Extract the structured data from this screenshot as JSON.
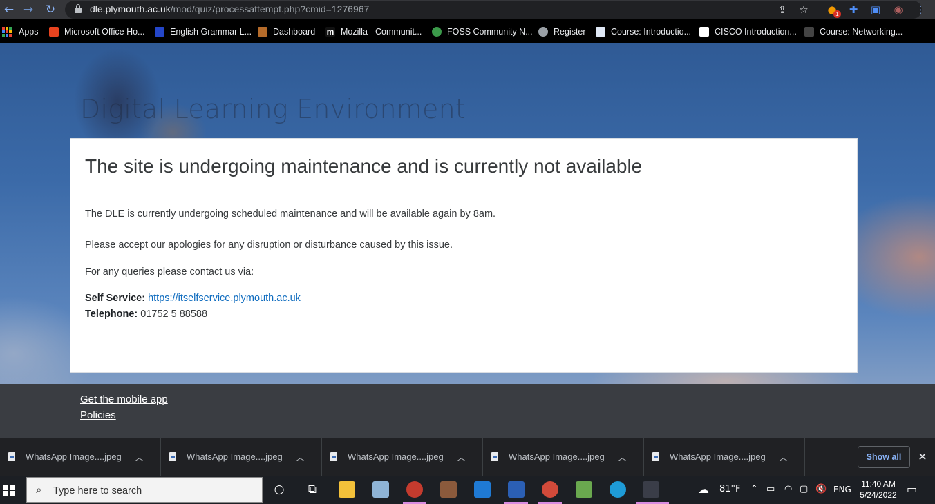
{
  "browser": {
    "url_host": "dle.plymouth.ac.uk",
    "url_path": "/mod/quiz/processattempt.php?cmid=1276967",
    "extension_badge": "1",
    "bookmarks": [
      {
        "label": "Apps"
      },
      {
        "label": "Microsoft Office Ho...",
        "color": "#e8431f"
      },
      {
        "label": "English Grammar L...",
        "color": "#2446c9"
      },
      {
        "label": "Dashboard",
        "color": "#b56b2a"
      },
      {
        "label": "Mozilla - Communit...",
        "color": "#111111"
      },
      {
        "label": "FOSS Community N...",
        "color": "#3b9a4a"
      },
      {
        "label": "Register",
        "color": "#9aa0a6"
      },
      {
        "label": "Course: Introductio...",
        "color": "#dfe8f5"
      },
      {
        "label": "CISCO Introduction...",
        "color": "#ffffff"
      },
      {
        "label": "Course: Networking...",
        "color": "#444444"
      }
    ]
  },
  "page": {
    "site_title": "Digital Learning Environment",
    "heading": "The site is undergoing maintenance and is currently not available",
    "paragraph1": "The DLE is currently undergoing scheduled maintenance and will be available again by 8am.",
    "paragraph2": "Please accept our apologies for any disruption or disturbance caused by this issue.",
    "paragraph3": "For any queries please contact us via:",
    "self_service_label": "Self Service:",
    "self_service_link": "https://itselfservice.plymouth.ac.uk",
    "telephone_label": "Telephone:",
    "telephone_value": "01752 5 88588",
    "footer_links": [
      "Get the mobile app",
      "Policies"
    ]
  },
  "downloads": {
    "items": [
      "WhatsApp Image....jpeg",
      "WhatsApp Image....jpeg",
      "WhatsApp Image....jpeg",
      "WhatsApp Image....jpeg",
      "WhatsApp Image....jpeg"
    ],
    "show_all": "Show all"
  },
  "taskbar": {
    "search_placeholder": "Type here to search",
    "weather": "81°F",
    "language": "ENG",
    "time": "11:40 AM",
    "date": "5/24/2022"
  }
}
